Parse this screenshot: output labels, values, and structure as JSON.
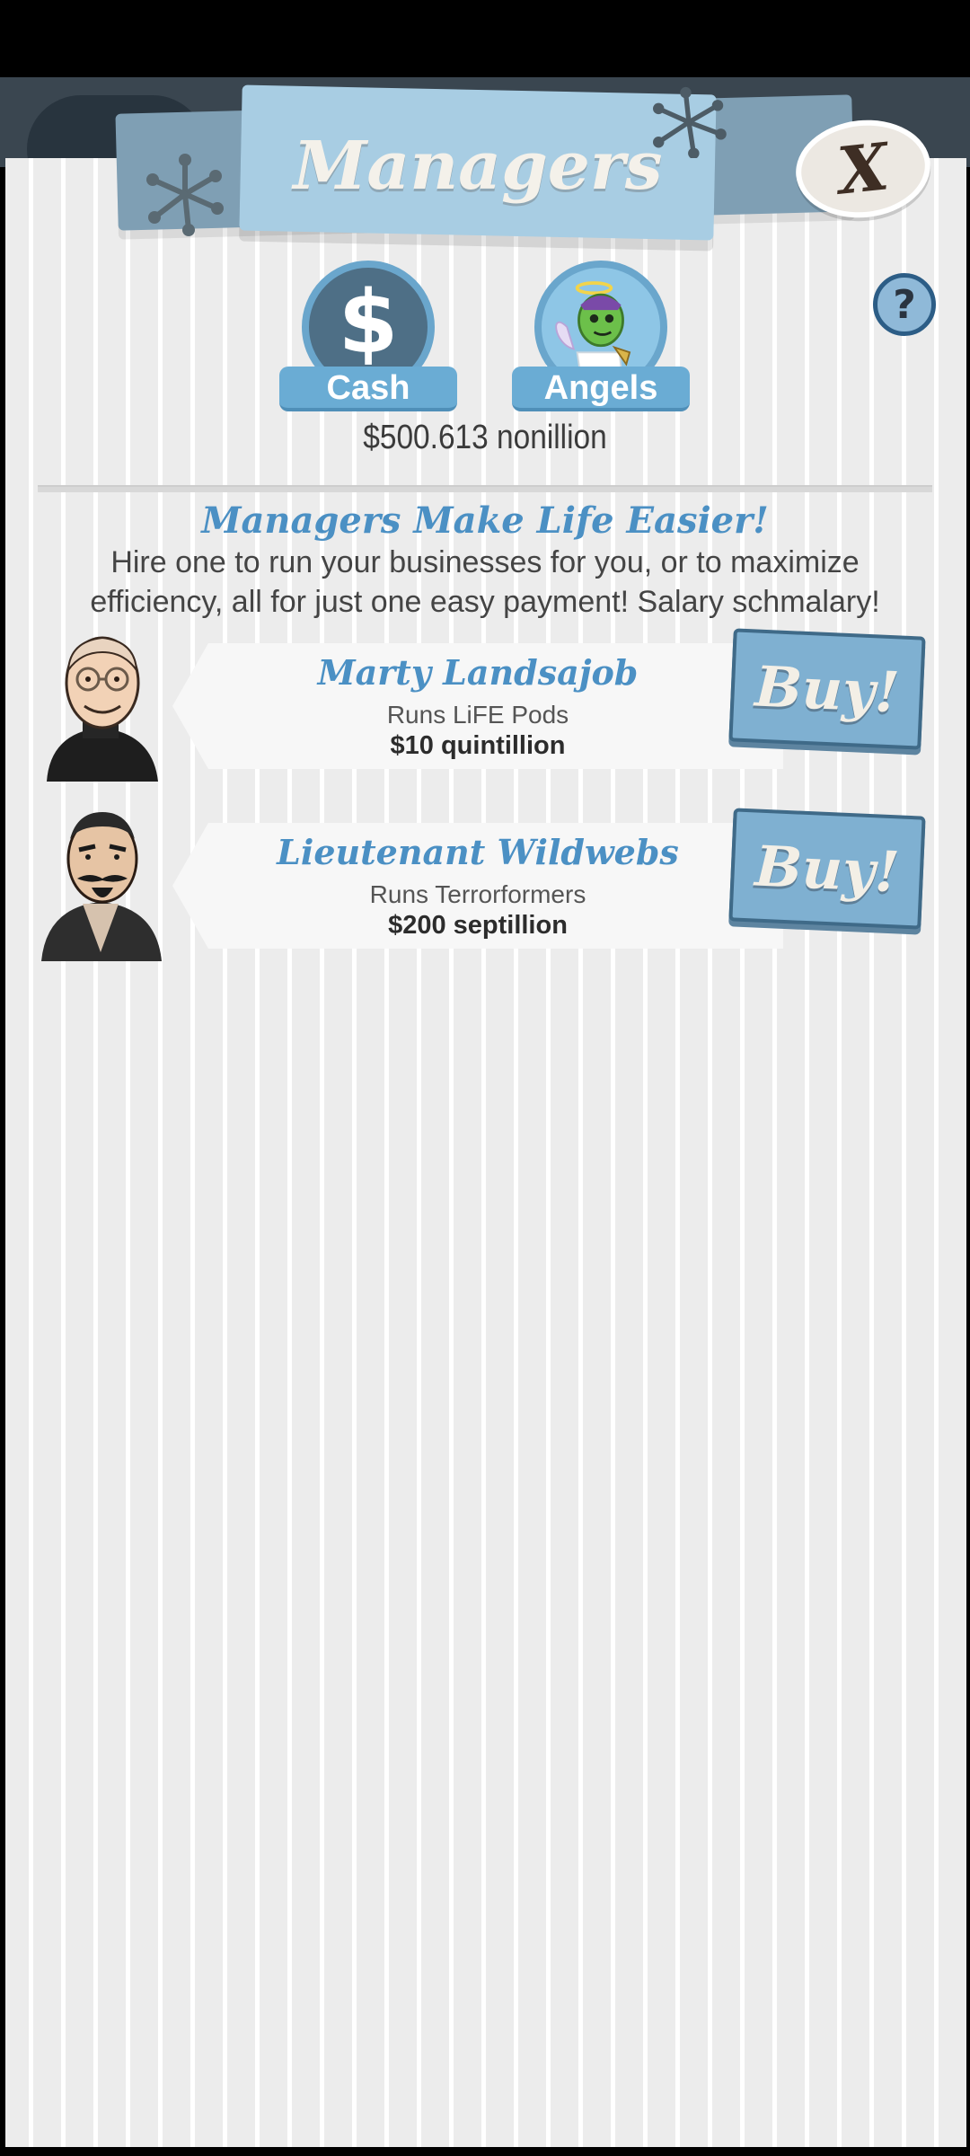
{
  "header": {
    "title": "Managers",
    "close_label": "X",
    "help_label": "?"
  },
  "tabs": [
    {
      "label": "Cash",
      "icon": "dollar-icon"
    },
    {
      "label": "Angels",
      "icon": "angel-icon"
    }
  ],
  "cash": {
    "amount": "$500.613 nonillion",
    "dollar_glyph": "$"
  },
  "intro": {
    "headline": "Managers Make Life Easier!",
    "description": "Hire one to run your businesses for you, or to maximize efficiency, all for just one easy payment! Salary schmalary!"
  },
  "managers": [
    {
      "name": "Marty Landsajob",
      "runs": "Runs LiFE Pods",
      "cost": "$10 quintillion",
      "button": "Buy!"
    },
    {
      "name": "Lieutenant Wildwebs",
      "runs": "Runs Terrorformers",
      "cost": "$200 septillion",
      "button": "Buy!"
    }
  ],
  "colors": {
    "accent": "#4b90c4",
    "tab": "#6aacd4",
    "button": "#7fb0d1",
    "panel": "#ececec"
  }
}
